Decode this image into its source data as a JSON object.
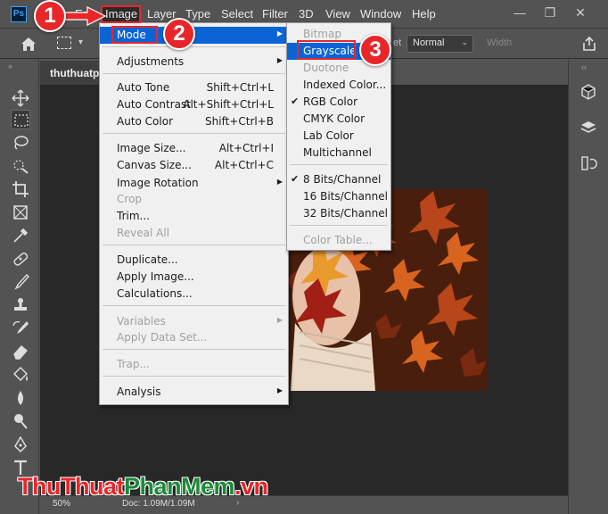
{
  "app": {
    "logo": "Ps"
  },
  "menubar": {
    "items": [
      "Edit",
      "Image",
      "Layer",
      "Type",
      "Select",
      "Filter",
      "3D",
      "View",
      "Window",
      "Help"
    ],
    "active": "Image"
  },
  "window_controls": {
    "minimize": "—",
    "restore": "❐",
    "close": "✕"
  },
  "options_bar": {
    "tolerance_label": "et",
    "style_value": "Normal",
    "width_label": "Width"
  },
  "document": {
    "tab_title": "thuthuatpl",
    "zoom": "50%",
    "doc_size": "Doc: 1.09M/1.09M"
  },
  "image_menu": {
    "items": [
      {
        "label": "Mode",
        "shortcut": "",
        "submenu": true,
        "disabled": false,
        "highlighted": true
      },
      {
        "label": "Adjustments",
        "shortcut": "",
        "submenu": true,
        "disabled": false
      },
      {
        "label": "Auto Tone",
        "shortcut": "Shift+Ctrl+L",
        "disabled": false
      },
      {
        "label": "Auto Contrast",
        "shortcut": "Alt+Shift+Ctrl+L",
        "disabled": false
      },
      {
        "label": "Auto Color",
        "shortcut": "Shift+Ctrl+B",
        "disabled": false
      },
      {
        "label": "Image Size...",
        "shortcut": "Alt+Ctrl+I",
        "disabled": false
      },
      {
        "label": "Canvas Size...",
        "shortcut": "Alt+Ctrl+C",
        "disabled": false
      },
      {
        "label": "Image Rotation",
        "shortcut": "",
        "submenu": true,
        "disabled": false
      },
      {
        "label": "Crop",
        "shortcut": "",
        "disabled": true
      },
      {
        "label": "Trim...",
        "shortcut": "",
        "disabled": false
      },
      {
        "label": "Reveal All",
        "shortcut": "",
        "disabled": true
      },
      {
        "label": "Duplicate...",
        "shortcut": "",
        "disabled": false
      },
      {
        "label": "Apply Image...",
        "shortcut": "",
        "disabled": false
      },
      {
        "label": "Calculations...",
        "shortcut": "",
        "disabled": false
      },
      {
        "label": "Variables",
        "shortcut": "",
        "submenu": true,
        "disabled": true
      },
      {
        "label": "Apply Data Set...",
        "shortcut": "",
        "disabled": true
      },
      {
        "label": "Trap...",
        "shortcut": "",
        "disabled": true
      },
      {
        "label": "Analysis",
        "shortcut": "",
        "submenu": true,
        "disabled": false
      }
    ]
  },
  "mode_menu": {
    "items": [
      {
        "label": "Bitmap",
        "disabled": true,
        "checked": false
      },
      {
        "label": "Grayscale",
        "disabled": false,
        "checked": false,
        "highlighted": true
      },
      {
        "label": "Duotone",
        "disabled": true,
        "checked": false
      },
      {
        "label": "Indexed Color...",
        "disabled": false,
        "checked": false
      },
      {
        "label": "RGB Color",
        "disabled": false,
        "checked": true
      },
      {
        "label": "CMYK Color",
        "disabled": false,
        "checked": false
      },
      {
        "label": "Lab Color",
        "disabled": false,
        "checked": false
      },
      {
        "label": "Multichannel",
        "disabled": false,
        "checked": false
      },
      {
        "label": "8 Bits/Channel",
        "disabled": false,
        "checked": true
      },
      {
        "label": "16 Bits/Channel",
        "disabled": false,
        "checked": false
      },
      {
        "label": "32 Bits/Channel",
        "disabled": false,
        "checked": false
      },
      {
        "label": "Color Table...",
        "disabled": true,
        "checked": false
      }
    ]
  },
  "annotations": {
    "step1": "1",
    "step2": "2",
    "step3": "3",
    "accent": "#e8262a"
  },
  "watermark": {
    "part1": "ThuThuat",
    "part2": "PhanMem",
    "part3": ".vn"
  },
  "tools": [
    "move-tool-icon",
    "marquee-tool-icon",
    "lasso-tool-icon",
    "quick-select-tool-icon",
    "crop-tool-icon",
    "frame-tool-icon",
    "eyedropper-tool-icon",
    "healing-brush-tool-icon",
    "brush-tool-icon",
    "clone-stamp-tool-icon",
    "history-brush-tool-icon",
    "eraser-tool-icon",
    "paint-bucket-tool-icon",
    "blur-tool-icon",
    "dodge-tool-icon",
    "pen-tool-icon",
    "type-tool-icon"
  ],
  "colors": {
    "menu_highlight": "#0a64d6",
    "menu_bg": "#f0f0f0",
    "ui_bg": "#535353",
    "canvas_bg": "#282828"
  }
}
